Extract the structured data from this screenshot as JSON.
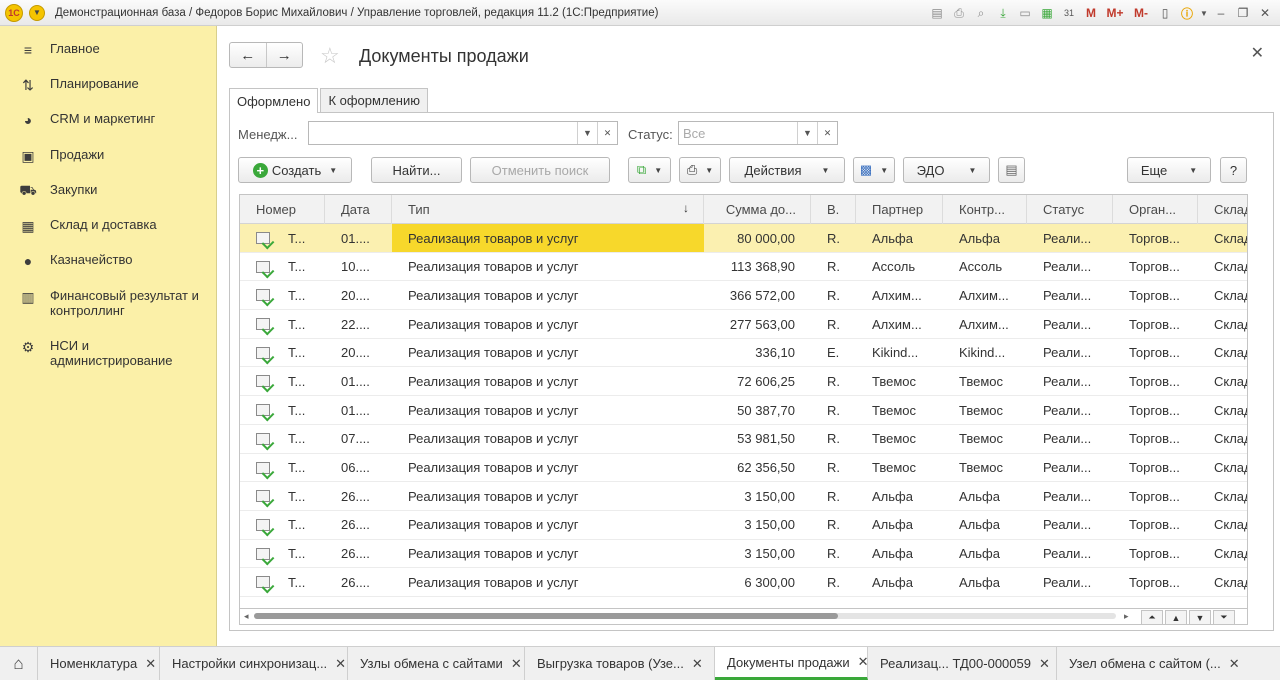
{
  "window": {
    "title": "Демонстрационная база / Федоров Борис Михайлович / Управление торговлей, редакция 11.2  (1С:Предприятие)",
    "logo_text": "1С",
    "toolbar_icons": [
      "save-icon",
      "print-icon",
      "find-icon",
      "calendar-icon",
      "link-icon",
      "printer-icon",
      "calculator-icon",
      "calendar-31-icon"
    ],
    "mem_buttons": [
      "M",
      "M+",
      "M-"
    ],
    "calendar_label": "31"
  },
  "sidebar": {
    "items": [
      {
        "label": "Главное",
        "icon": "menu-icon"
      },
      {
        "label": "Планирование",
        "icon": "planning-icon"
      },
      {
        "label": "CRM и маркетинг",
        "icon": "pie-chart-icon"
      },
      {
        "label": "Продажи",
        "icon": "bag-icon"
      },
      {
        "label": "Закупки",
        "icon": "cart-icon"
      },
      {
        "label": "Склад и доставка",
        "icon": "warehouse-icon"
      },
      {
        "label": "Казначейство",
        "icon": "coin-icon"
      },
      {
        "label": "Финансовый результат и контроллинг",
        "icon": "bar-chart-icon"
      },
      {
        "label": "НСИ и администрирование",
        "icon": "gear-icon"
      }
    ]
  },
  "form": {
    "title": "Документы продажи",
    "tabs": [
      "Оформлено",
      "К оформлению"
    ],
    "filters": {
      "manager_label": "Менедж...",
      "manager_value": "",
      "status_label": "Статус:",
      "status_placeholder": "Все"
    },
    "commands": {
      "create": "Создать",
      "find": "Найти...",
      "cancel_search": "Отменить поиск",
      "actions": "Действия",
      "edo": "ЭДО",
      "more": "Еще",
      "help": "?"
    }
  },
  "table": {
    "columns": [
      "Номер",
      "Дата",
      "Тип",
      "Сумма до...",
      "В.",
      "Партнер",
      "Контр...",
      "Статус",
      "Орган...",
      "Склад"
    ],
    "rows": [
      {
        "number": "Т...",
        "date": "01....",
        "type": "Реализация товаров и услуг",
        "sum": "80 000,00",
        "currency": "R.",
        "partner": "Альфа",
        "counterparty": "Альфа",
        "status": "Реали...",
        "org": "Торгов...",
        "warehouse": "Склад",
        "selected": true
      },
      {
        "number": "Т...",
        "date": "10....",
        "type": "Реализация товаров и услуг",
        "sum": "113 368,90",
        "currency": "R.",
        "partner": "Ассоль",
        "counterparty": "Ассоль",
        "status": "Реали...",
        "org": "Торгов...",
        "warehouse": "Склад"
      },
      {
        "number": "Т...",
        "date": "20....",
        "type": "Реализация товаров и услуг",
        "sum": "366 572,00",
        "currency": "R.",
        "partner": "Алхим...",
        "counterparty": "Алхим...",
        "status": "Реали...",
        "org": "Торгов...",
        "warehouse": "Склад"
      },
      {
        "number": "Т...",
        "date": "22....",
        "type": "Реализация товаров и услуг",
        "sum": "277 563,00",
        "currency": "R.",
        "partner": "Алхим...",
        "counterparty": "Алхим...",
        "status": "Реали...",
        "org": "Торгов...",
        "warehouse": "Склад"
      },
      {
        "number": "Т...",
        "date": "20....",
        "type": "Реализация товаров и услуг",
        "sum": "336,10",
        "currency": "E.",
        "partner": "Kikind...",
        "counterparty": "Kikind...",
        "status": "Реали...",
        "org": "Торгов...",
        "warehouse": "Склад"
      },
      {
        "number": "Т...",
        "date": "01....",
        "type": "Реализация товаров и услуг",
        "sum": "72 606,25",
        "currency": "R.",
        "partner": "Твемос",
        "counterparty": "Твемос",
        "status": "Реали...",
        "org": "Торгов...",
        "warehouse": "Склад"
      },
      {
        "number": "Т...",
        "date": "01....",
        "type": "Реализация товаров и услуг",
        "sum": "50 387,70",
        "currency": "R.",
        "partner": "Твемос",
        "counterparty": "Твемос",
        "status": "Реали...",
        "org": "Торгов...",
        "warehouse": "Склад"
      },
      {
        "number": "Т...",
        "date": "07....",
        "type": "Реализация товаров и услуг",
        "sum": "53 981,50",
        "currency": "R.",
        "partner": "Твемос",
        "counterparty": "Твемос",
        "status": "Реали...",
        "org": "Торгов...",
        "warehouse": "Склад"
      },
      {
        "number": "Т...",
        "date": "06....",
        "type": "Реализация товаров и услуг",
        "sum": "62 356,50",
        "currency": "R.",
        "partner": "Твемос",
        "counterparty": "Твемос",
        "status": "Реали...",
        "org": "Торгов...",
        "warehouse": "Склад"
      },
      {
        "number": "Т...",
        "date": "26....",
        "type": "Реализация товаров и услуг",
        "sum": "3 150,00",
        "currency": "R.",
        "partner": "Альфа",
        "counterparty": "Альфа",
        "status": "Реали...",
        "org": "Торгов...",
        "warehouse": "Склад"
      },
      {
        "number": "Т...",
        "date": "26....",
        "type": "Реализация товаров и услуг",
        "sum": "3 150,00",
        "currency": "R.",
        "partner": "Альфа",
        "counterparty": "Альфа",
        "status": "Реали...",
        "org": "Торгов...",
        "warehouse": "Склад"
      },
      {
        "number": "Т...",
        "date": "26....",
        "type": "Реализация товаров и услуг",
        "sum": "3 150,00",
        "currency": "R.",
        "partner": "Альфа",
        "counterparty": "Альфа",
        "status": "Реали...",
        "org": "Торгов...",
        "warehouse": "Склад"
      },
      {
        "number": "Т...",
        "date": "26....",
        "type": "Реализация товаров и услуг",
        "sum": "6 300,00",
        "currency": "R.",
        "partner": "Альфа",
        "counterparty": "Альфа",
        "status": "Реали...",
        "org": "Торгов...",
        "warehouse": "Склад"
      }
    ]
  },
  "taskbar": {
    "tabs": [
      {
        "label": "Номенклатура"
      },
      {
        "label": "Настройки синхронизац..."
      },
      {
        "label": "Узлы обмена с сайтами"
      },
      {
        "label": "Выгрузка товаров (Узе..."
      },
      {
        "label": "Документы продажи",
        "active": true
      },
      {
        "label": "Реализац... ТД00-000059"
      },
      {
        "label": "Узел обмена с сайтом (..."
      }
    ]
  },
  "colors": {
    "sidebar_bg": "#fbf0a8",
    "selected_row": "#fbf0b0",
    "highlight_cell": "#f7d82b",
    "accent_green": "#3aa83a"
  }
}
